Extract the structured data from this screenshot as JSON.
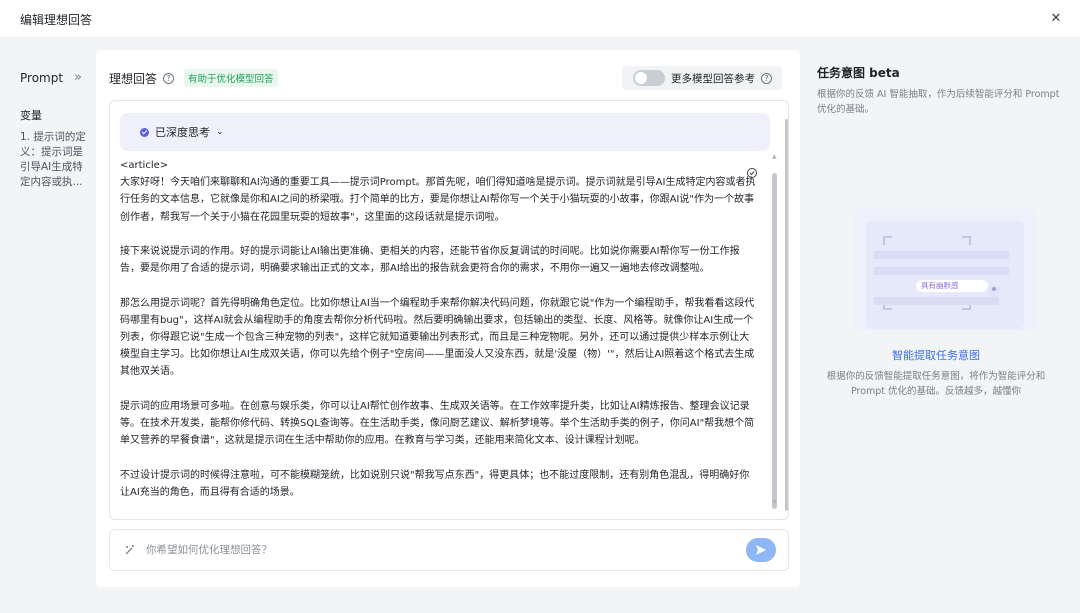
{
  "dialog": {
    "title": "编辑理想回答"
  },
  "sidebar": {
    "prompt_label": "Prompt",
    "collapse_icon": "double-chevron-right-icon",
    "variables_label": "变量",
    "variable_item": "1. 提示词的定义：提示词是引导AI生成特定内容或执..."
  },
  "main": {
    "title": "理想回答",
    "tag": "有助于优化模型回答",
    "toggle_label": "更多模型回答参考",
    "toggle_on": false,
    "thinking_label": "已深度思考",
    "answer_text": "<article>\n大家好呀！今天咱们来聊聊和AI沟通的重要工具——提示词Prompt。那首先呢，咱们得知道啥是提示词。提示词就是引导AI生成特定内容或者执行任务的文本信息，它就像是你和AI之间的桥梁哦。打个简单的比方，要是你想让AI帮你写一个关于小猫玩耍的小故事，你跟AI说\"作为一个故事创作者，帮我写一个关于小猫在花园里玩耍的短故事\"，这里面的这段话就是提示词啦。\n\n接下来说说提示词的作用。好的提示词能让AI输出更准确、更相关的内容，还能节省你反复调试的时间呢。比如说你需要AI帮你写一份工作报告，要是你用了合适的提示词，明确要求输出正式的文本，那AI给出的报告就会更符合你的需求，不用你一遍又一遍地去修改调整啦。\n\n那怎么用提示词呢？首先得明确角色定位。比如你想让AI当一个编程助手来帮你解决代码问题，你就跟它说\"作为一个编程助手，帮我看看这段代码哪里有bug\"，这样AI就会从编程助手的角度去帮你分析代码啦。然后要明确输出要求，包括输出的类型、长度、风格等。就像你让AI生成一个列表，你得跟它说\"生成一个包含三种宠物的列表\"，这样它就知道要输出列表形式，而且是三种宠物呢。另外，还可以通过提供少样本示例让大模型自主学习。比如你想让AI生成双关语，你可以先给个例子\"空房间——里面没人又没东西，就是'没屋（物）'\"，然后让AI照着这个格式去生成其他双关语。\n\n提示词的应用场景可多啦。在创意与娱乐类，你可以让AI帮忙创作故事、生成双关语等。在工作效率提升类，比如让AI精炼报告、整理会议记录等。在技术开发类，能帮你修代码、转换SQL查询等。在生活助手类，像问厨艺建议、解析梦境等。举个生活助手类的例子，你问AI\"帮我想个简单又营养的早餐食谱\"，这就是提示词在生活中帮助你的应用。在教育与学习类，还能用来简化文本、设计课程计划呢。\n\n不过设计提示词的时候得注意啦，可不能模糊笼统，比如说别只说\"帮我写点东西\"，得更具体；也不能过度限制，还有别角色混乱，得明确好你让AI充当的角色，而且得有合适的场景。",
    "input_placeholder": "你希望如何优化理想回答？",
    "send_icon": "send-icon"
  },
  "right_panel": {
    "title": "任务意图 beta",
    "description": "根据你的反馈 AI 智能抽取，作为后续智能评分和 Prompt 优化的基础。",
    "illustration_badge": "具有幽默感",
    "link": "智能提取任务意图",
    "sub_description": "根据你的反馈智能提取任务意图，将作为智能评分和 Prompt 优化的基础。反馈越多，越懂你"
  },
  "colors": {
    "accent": "#3a6fe8",
    "tag_green": "#20a05a",
    "think_bg": "#eff0fb",
    "send": "#8fb7f5"
  }
}
